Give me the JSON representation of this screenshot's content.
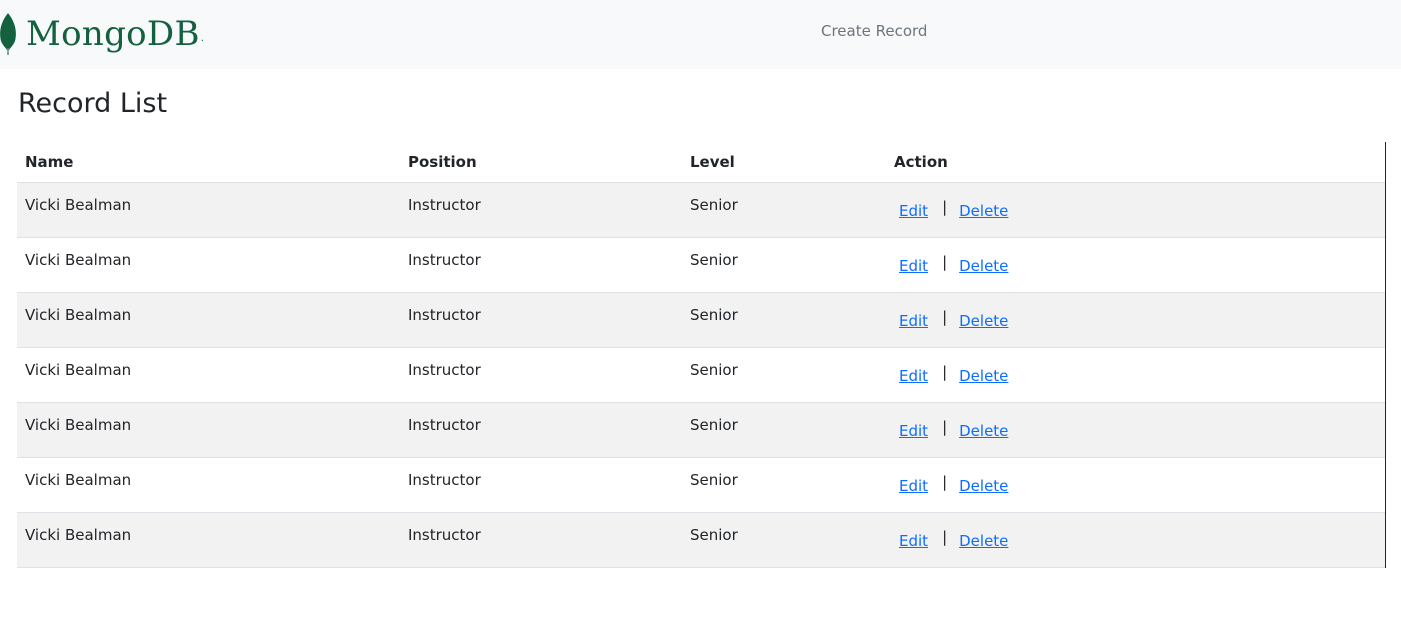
{
  "navbar": {
    "brand_text": "MongoDB",
    "brand_mark": ".",
    "create_link": "Create Record"
  },
  "page": {
    "title": "Record List"
  },
  "table": {
    "headers": [
      "Name",
      "Position",
      "Level",
      "Action"
    ],
    "rows": [
      {
        "name": "Vicki Bealman",
        "position": "Instructor",
        "level": "Senior",
        "edit": "Edit",
        "separator": "|",
        "delete": "Delete"
      },
      {
        "name": "Vicki Bealman",
        "position": "Instructor",
        "level": "Senior",
        "edit": "Edit",
        "separator": "|",
        "delete": "Delete"
      },
      {
        "name": "Vicki Bealman",
        "position": "Instructor",
        "level": "Senior",
        "edit": "Edit",
        "separator": "|",
        "delete": "Delete"
      },
      {
        "name": "Vicki Bealman",
        "position": "Instructor",
        "level": "Senior",
        "edit": "Edit",
        "separator": "|",
        "delete": "Delete"
      },
      {
        "name": "Vicki Bealman",
        "position": "Instructor",
        "level": "Senior",
        "edit": "Edit",
        "separator": "|",
        "delete": "Delete"
      },
      {
        "name": "Vicki Bealman",
        "position": "Instructor",
        "level": "Senior",
        "edit": "Edit",
        "separator": "|",
        "delete": "Delete"
      },
      {
        "name": "Vicki Bealman",
        "position": "Instructor",
        "level": "Senior",
        "edit": "Edit",
        "separator": "|",
        "delete": "Delete"
      }
    ]
  },
  "colors": {
    "brand_green": "#13613e",
    "link_blue": "#0d6efd",
    "navbar_bg": "#f8f9fa",
    "stripe_bg": "#f2f2f2"
  },
  "icons": {
    "brand_logo": "mongodb-leaf-icon"
  }
}
